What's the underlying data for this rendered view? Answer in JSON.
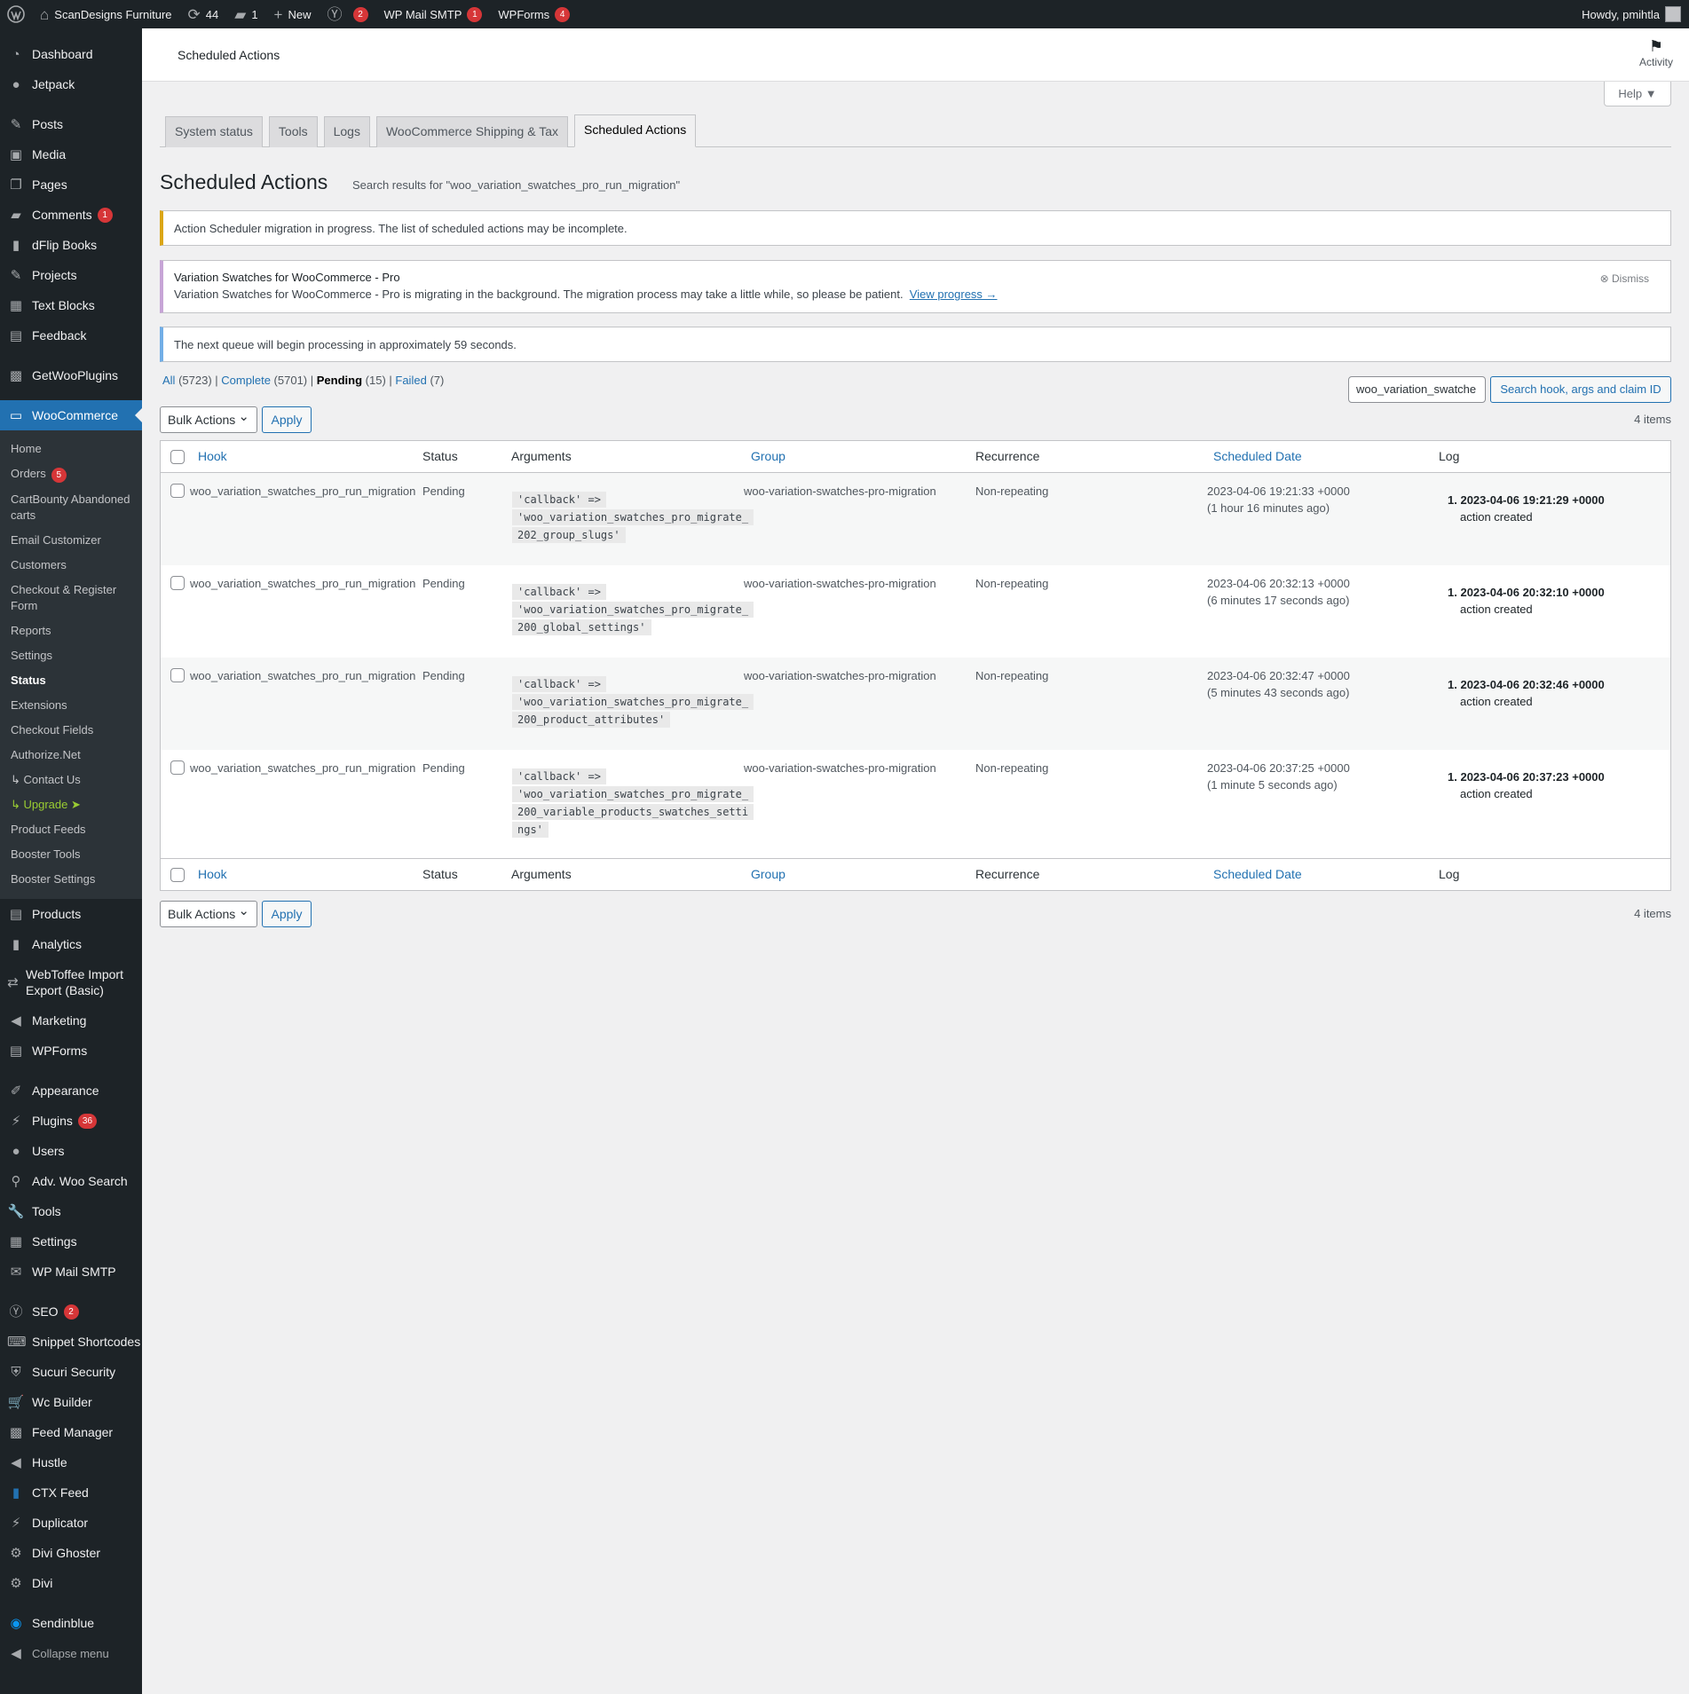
{
  "adminbar": {
    "site_name": "ScanDesigns Furniture",
    "updates_count": "44",
    "comments_count": "1",
    "new_label": "New",
    "yoast_badge": "2",
    "smtp_label": "WP Mail SMTP",
    "smtp_badge": "1",
    "wpforms_label": "WPForms",
    "wpforms_badge": "4",
    "howdy": "Howdy, pmihtla"
  },
  "sidebar": {
    "dashboard": "Dashboard",
    "jetpack": "Jetpack",
    "posts": "Posts",
    "media": "Media",
    "pages": "Pages",
    "comments": "Comments",
    "comments_badge": "1",
    "dflip": "dFlip Books",
    "projects": "Projects",
    "text_blocks": "Text Blocks",
    "feedback": "Feedback",
    "getwooplugins": "GetWooPlugins",
    "woocommerce": "WooCommerce",
    "woo_sub": {
      "home": "Home",
      "orders": "Orders",
      "orders_badge": "5",
      "cartbounty": "CartBounty Abandoned carts",
      "email_customizer": "Email Customizer",
      "customers": "Customers",
      "checkout_register": "Checkout & Register Form",
      "reports": "Reports",
      "settings": "Settings",
      "status": "Status",
      "extensions": "Extensions",
      "checkout_fields": "Checkout Fields",
      "authorize_net": "Authorize.Net",
      "contact_us": "↳ Contact Us",
      "upgrade": "↳ Upgrade",
      "product_feeds": "Product Feeds",
      "booster_tools": "Booster Tools",
      "booster_settings": "Booster Settings"
    },
    "products": "Products",
    "analytics": "Analytics",
    "webtoffee": "WebToffee Import Export (Basic)",
    "marketing": "Marketing",
    "wpforms": "WPForms",
    "appearance": "Appearance",
    "plugins": "Plugins",
    "plugins_badge": "36",
    "users": "Users",
    "adv_woo_search": "Adv. Woo Search",
    "tools": "Tools",
    "settings": "Settings",
    "wp_mail_smtp": "WP Mail SMTP",
    "seo": "SEO",
    "seo_badge": "2",
    "snippet": "Snippet Shortcodes",
    "sucuri": "Sucuri Security",
    "wc_builder": "Wc Builder",
    "feed_manager": "Feed Manager",
    "hustle": "Hustle",
    "ctx_feed": "CTX Feed",
    "duplicator": "Duplicator",
    "divi_ghoster": "Divi Ghoster",
    "divi": "Divi",
    "sendinblue": "Sendinblue",
    "collapse": "Collapse menu"
  },
  "header": {
    "title": "Scheduled Actions",
    "activity": "Activity",
    "help": "Help ▼"
  },
  "tabs": [
    "System status",
    "Tools",
    "Logs",
    "WooCommerce Shipping & Tax",
    "Scheduled Actions"
  ],
  "page": {
    "heading": "Scheduled Actions",
    "search_subtitle": "Search results for \"woo_variation_swatches_pro_run_migration\""
  },
  "notices": {
    "migration": "Action Scheduler migration in progress. The list of scheduled actions may be incomplete.",
    "swatches_title": "Variation Swatches for WooCommerce - Pro",
    "swatches_text": "Variation Swatches for WooCommerce - Pro is migrating in the background. The migration process may take a little while, so please be patient.",
    "view_progress": "View progress →",
    "dismiss": "Dismiss",
    "queue": "The next queue will begin processing in approximately 59 seconds."
  },
  "filters": {
    "all": "All",
    "all_count": "(5723) |",
    "complete": "Complete",
    "complete_count": "(5701) |",
    "pending": "Pending",
    "pending_count": "(15) |",
    "failed": "Failed",
    "failed_count": "(7)"
  },
  "search": {
    "value": "woo_variation_swatche",
    "button": "Search hook, args and claim ID"
  },
  "bulk": {
    "label": "Bulk Actions",
    "apply": "Apply",
    "items": "4 items"
  },
  "columns": {
    "hook": "Hook",
    "status": "Status",
    "arguments": "Arguments",
    "group": "Group",
    "recurrence": "Recurrence",
    "scheduled_date": "Scheduled Date",
    "log": "Log"
  },
  "rows": [
    {
      "hook": "woo_variation_swatches_pro_run_migration",
      "status": "Pending",
      "arg_key": "'callback' =>",
      "arg_val1": "'woo_variation_swatches_pro_migrate_",
      "arg_val2": "202_group_slugs'",
      "arg_val3": "",
      "group": "woo-variation-swatches-pro-migration",
      "recurrence": "Non-repeating",
      "date": "2023-04-06 19:21:33 +0000",
      "relative": "(1 hour 16 minutes ago)",
      "log_date": "2023-04-06 19:21:29 +0000",
      "log_msg": "action created"
    },
    {
      "hook": "woo_variation_swatches_pro_run_migration",
      "status": "Pending",
      "arg_key": "'callback' =>",
      "arg_val1": "'woo_variation_swatches_pro_migrate_",
      "arg_val2": "200_global_settings'",
      "arg_val3": "",
      "group": "woo-variation-swatches-pro-migration",
      "recurrence": "Non-repeating",
      "date": "2023-04-06 20:32:13 +0000",
      "relative": "(6 minutes 17 seconds ago)",
      "log_date": "2023-04-06 20:32:10 +0000",
      "log_msg": "action created"
    },
    {
      "hook": "woo_variation_swatches_pro_run_migration",
      "status": "Pending",
      "arg_key": "'callback' =>",
      "arg_val1": "'woo_variation_swatches_pro_migrate_",
      "arg_val2": "200_product_attributes'",
      "arg_val3": "",
      "group": "woo-variation-swatches-pro-migration",
      "recurrence": "Non-repeating",
      "date": "2023-04-06 20:32:47 +0000",
      "relative": "(5 minutes 43 seconds ago)",
      "log_date": "2023-04-06 20:32:46 +0000",
      "log_msg": "action created"
    },
    {
      "hook": "woo_variation_swatches_pro_run_migration",
      "status": "Pending",
      "arg_key": "'callback' =>",
      "arg_val1": "'woo_variation_swatches_pro_migrate_",
      "arg_val2": "200_variable_products_swatches_setti",
      "arg_val3": "ngs'",
      "group": "woo-variation-swatches-pro-migration",
      "recurrence": "Non-repeating",
      "date": "2023-04-06 20:37:25 +0000",
      "relative": "(1 minute 5 seconds ago)",
      "log_date": "2023-04-06 20:37:23 +0000",
      "log_msg": "action created"
    }
  ],
  "colors": {
    "admin_dark": "#1d2327",
    "accent_blue": "#2271b1",
    "badge_red": "#d63638",
    "warning_yellow": "#dba617",
    "info_blue": "#72aee6"
  }
}
